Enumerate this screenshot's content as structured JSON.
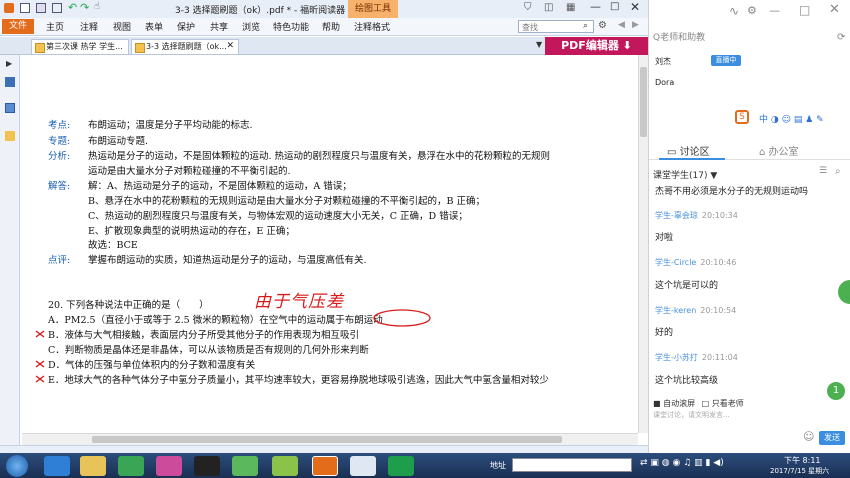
{
  "window": {
    "title": "3-3 选择题刷题（ok）.pdf * - 福昕阅读器",
    "tool_tab": "绘图工具",
    "search_placeholder": "查找"
  },
  "menu": {
    "file": "文件",
    "items": [
      "主页",
      "注释",
      "视图",
      "表单",
      "保护",
      "共享",
      "浏览",
      "特色功能",
      "帮助",
      "注释格式"
    ]
  },
  "tabs": [
    {
      "label": "第三次课 热学 学生..."
    },
    {
      "label": "3-3 选择题刷题（ok..."
    }
  ],
  "pdf_editor_label": "PDF编辑器",
  "document": {
    "kaodian_label": "考点:",
    "kaodian": "布朗运动；温度是分子平均动能的标志.",
    "zhuanti_label": "专题:",
    "zhuanti": "布朗运动专题.",
    "fenxi_label": "分析:",
    "fenxi_1": "热运动是分子的运动，不是固体颗粒的运动. 热运动的剧烈程度只与温度有关，悬浮在水中的花粉颗粒的无规则",
    "fenxi_2": "运动是由大量水分子对颗粒碰撞的不平衡引起的.",
    "jieda_label": "解答:",
    "jieda_1": "解：A、热运动是分子的运动，不是固体颗粒的运动，A 错误；",
    "jieda_2": "B、悬浮在水中的花粉颗粒的无规则运动是由大量水分子对颗粒碰撞的不平衡引起的，B 正确；",
    "jieda_3": "C、热运动的剧烈程度只与温度有关，与物体宏观的运动速度大小无关，C 正确，D 错误；",
    "jieda_4": "E、扩散现象典型的说明热运动的存在，E 正确；",
    "jieda_5": "故选：BCE",
    "dianping_label": "点评:",
    "dianping": "掌握布朗运动的实质，知道热运动是分子的运动，与温度高低有关.",
    "q20": "20. 下列各种说法中正确的是（　　）",
    "optA": "A．PM2.5（直径小于或等于 2.5 微米的颗粒物）在空气中的运动属于布朗运动",
    "optB": "B．液体与大气相接触，表面层内分子所受其他分子的作用表现为相互吸引",
    "optC": "C．判断物质是晶体还是非晶体，可以从该物质是否有规则的几何外形来判断",
    "optD": "D．气体的压强与单位体积内的分子数和温度有关",
    "optE": "E．地球大气的各种气体分子中氢分子质量小，其平均速率较大，更容易挣脱地球吸引逃逸，因此大气中氢含量相对较少",
    "handwriting": "由于气压差"
  },
  "panel": {
    "search_placeholder": "Q老师和助教",
    "teacher": "刘杰",
    "teacher_badge": "直播中",
    "assistant": "Dora",
    "tab_discuss": "讨论区",
    "tab_office": "办公室",
    "students_label": "课堂学生(17)",
    "messages": [
      {
        "name": "",
        "time": "",
        "text": "杰哥不用必须是水分子的无规则运动吗"
      },
      {
        "name": "学生-辜会琼",
        "time": "20:10:34",
        "text": "对啦"
      },
      {
        "name": "学生-Circle",
        "time": "20:10:46",
        "text": "这个坑是可以的"
      },
      {
        "name": "学生-keren",
        "time": "20:10:54",
        "text": "好的"
      },
      {
        "name": "学生-小苏打",
        "time": "20:11:04",
        "text": "这个坑比较高级"
      }
    ],
    "auto_scroll": "自动滚屏",
    "only_teacher": "只看老师",
    "input_placeholder": "课堂讨论，请文明发言...",
    "send": "发送",
    "badge_count": "1"
  },
  "taskbar": {
    "address_label": "地址",
    "time": "下午 8:11",
    "date": "2017/7/15 星期六"
  }
}
